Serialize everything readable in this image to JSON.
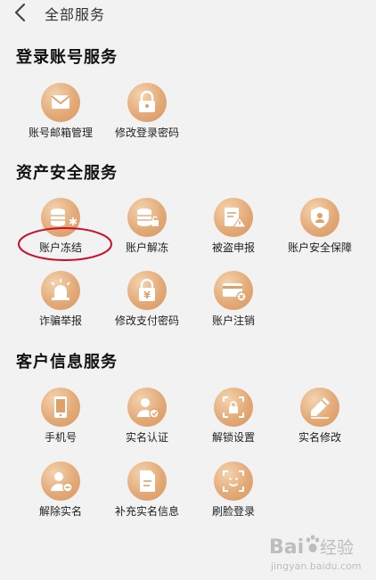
{
  "header": {
    "title": "全部服务"
  },
  "sections": [
    {
      "title": "登录账号服务",
      "items": [
        {
          "label": "账号邮箱管理",
          "icon": "envelope-icon"
        },
        {
          "label": "修改登录密码",
          "icon": "lock-icon"
        }
      ]
    },
    {
      "title": "资产安全服务",
      "items": [
        {
          "label": "账户冻结",
          "icon": "coins-freeze-icon"
        },
        {
          "label": "账户解冻",
          "icon": "coins-unlock-icon"
        },
        {
          "label": "被盗申报",
          "icon": "report-warning-icon"
        },
        {
          "label": "账户安全保障",
          "icon": "shield-user-icon"
        },
        {
          "label": "诈骗举报",
          "icon": "alarm-light-icon"
        },
        {
          "label": "修改支付密码",
          "icon": "yen-lock-icon"
        },
        {
          "label": "账户注销",
          "icon": "card-cancel-icon"
        }
      ]
    },
    {
      "title": "客户信息服务",
      "items": [
        {
          "label": "手机号",
          "icon": "phone-icon"
        },
        {
          "label": "实名认证",
          "icon": "user-verify-icon"
        },
        {
          "label": "解锁设置",
          "icon": "scan-lock-icon"
        },
        {
          "label": "实名修改",
          "icon": "pencil-icon"
        },
        {
          "label": "解除实名",
          "icon": "user-remove-icon"
        },
        {
          "label": "补充实名信息",
          "icon": "document-icon"
        },
        {
          "label": "刷脸登录",
          "icon": "face-scan-icon"
        }
      ]
    }
  ],
  "colors": {
    "icon_circle": "#e3aa78",
    "icon_glyph": "#ffffff",
    "annotation": "#c8102e",
    "background": "#f2f2f2"
  },
  "watermark": {
    "brand": "Baidu",
    "tagline": "经验",
    "url": "jingyan.baidu.com"
  }
}
